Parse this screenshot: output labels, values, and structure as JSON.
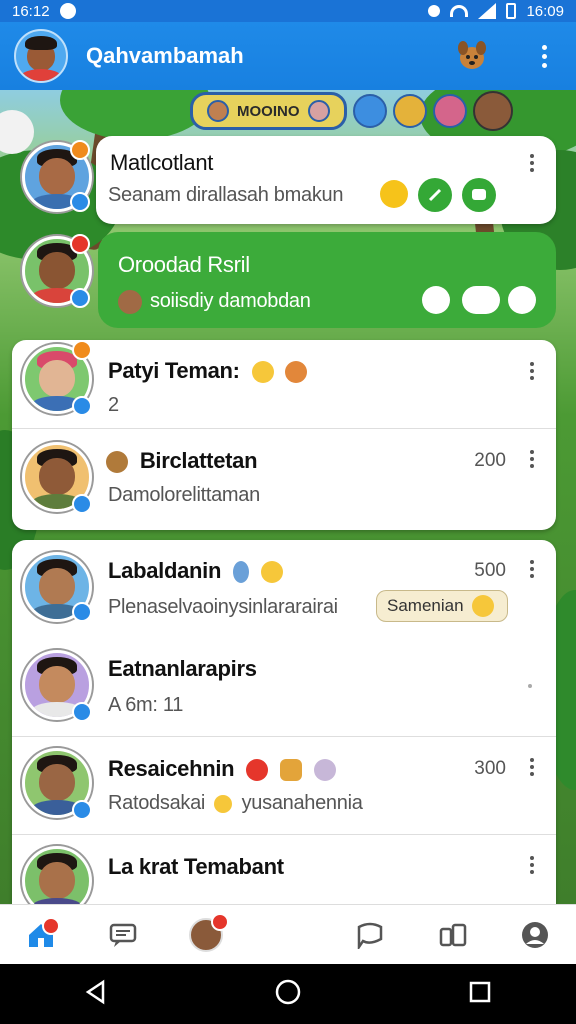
{
  "status_bar": {
    "time_left": "16:12",
    "time_right": "16:09"
  },
  "app_bar": {
    "title": "Qahvambamah"
  },
  "story_strip": {
    "pill_label": "MOOINO"
  },
  "chats": [
    {
      "name": "Matlcotlant",
      "preview": "Seanam dirallasah bmakun",
      "style": "bubble-white"
    },
    {
      "name": "Oroodad Rsril",
      "preview": "soiisdiy damobdan",
      "style": "bubble-green"
    },
    {
      "name": "Patyi Teman:",
      "preview": "2"
    },
    {
      "name": "Birclattetan",
      "preview": "Damolorelittaman",
      "time": "200"
    },
    {
      "name": "Labaldanin",
      "preview": "Plenaselvaoinysinlararairai",
      "time": "500",
      "chip": "Samenian"
    },
    {
      "name": "Eatnanlarapirs",
      "preview": "A 6m: 11",
      "time": ""
    },
    {
      "name": "Resaicehnin",
      "preview": "Ratodsakai",
      "preview2": "yusanahennia",
      "time": "300"
    },
    {
      "name": "La krat Temabant",
      "preview": ""
    }
  ],
  "colors": {
    "accent": "#1f8ae8",
    "green_bubble": "#3cab3a",
    "verify": "#2a8be6"
  },
  "bottom_nav": [
    "home-icon",
    "chat-list-icon",
    "profile-photo",
    "chat-bubble-icon",
    "contacts-icon",
    "account-icon"
  ]
}
